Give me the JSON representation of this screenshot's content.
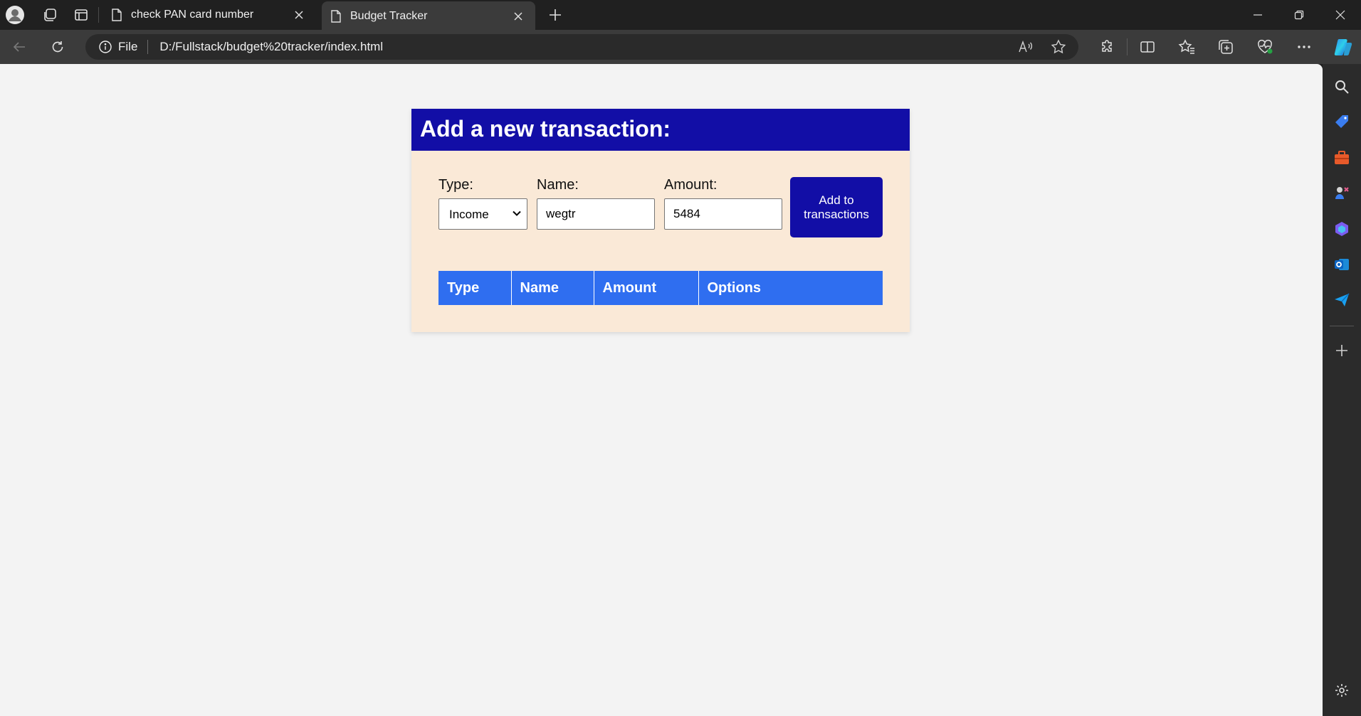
{
  "browser": {
    "tabs": [
      {
        "title": "check PAN card number",
        "active": false
      },
      {
        "title": "Budget Tracker",
        "active": true
      }
    ],
    "address": {
      "scheme_label": "File",
      "url": "D:/Fullstack/budget%20tracker/index.html"
    }
  },
  "page": {
    "heading": "Add a new transaction:",
    "form": {
      "type_label": "Type:",
      "type_value": "Income",
      "type_options": [
        "Income"
      ],
      "name_label": "Name:",
      "name_value": "wegtr",
      "amount_label": "Amount:",
      "amount_value": "5484",
      "submit_label": "Add to transactions"
    },
    "table": {
      "columns": [
        "Type",
        "Name",
        "Amount",
        "Options"
      ],
      "rows": []
    }
  },
  "colors": {
    "header_blue": "#120ea6",
    "table_header_blue": "#2f6ef0",
    "card_bg": "#fae9d7",
    "page_bg": "#f3f3f3"
  }
}
